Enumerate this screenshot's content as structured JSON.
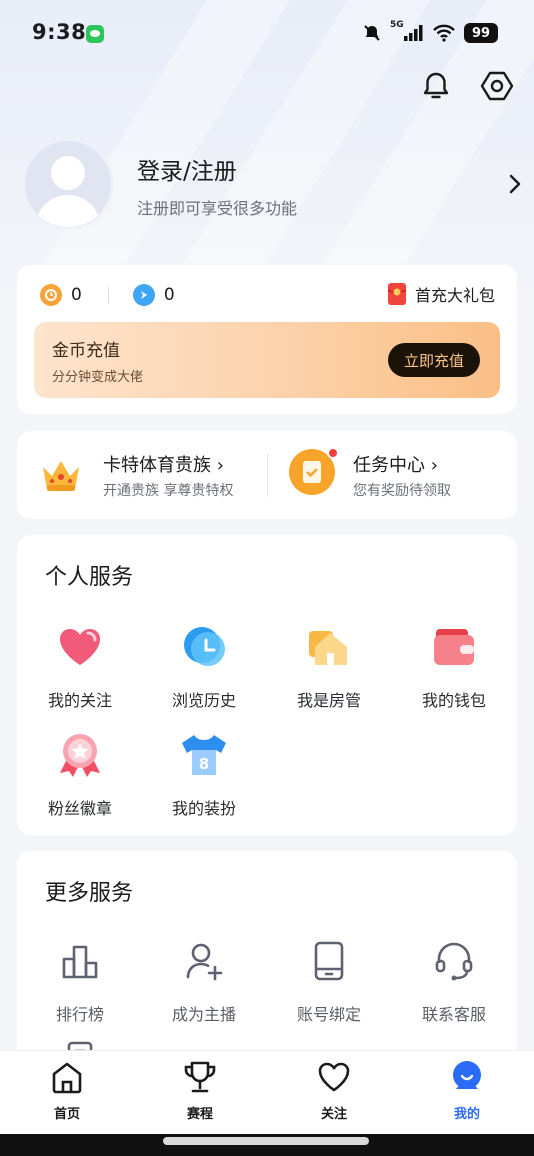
{
  "status_bar": {
    "time": "9:38",
    "network": "5G",
    "battery": "99"
  },
  "profile": {
    "title": "登录/注册",
    "subtitle": "注册即可享受很多功能"
  },
  "wallet": {
    "coin_count": "0",
    "diamond_count": "0",
    "gift_label": "首充大礼包",
    "recharge_title": "金币充值",
    "recharge_subtitle": "分分钟变成大佬",
    "recharge_button": "立即充值"
  },
  "promo": {
    "vip_title": "卡特体育贵族 ›",
    "vip_subtitle": "开通贵族 享尊贵特权",
    "task_title": "任务中心 ›",
    "task_subtitle": "您有奖励待领取"
  },
  "personal_services": {
    "title": "个人服务",
    "items": [
      {
        "label": "我的关注",
        "icon": "heart-icon"
      },
      {
        "label": "浏览历史",
        "icon": "clock-icon"
      },
      {
        "label": "我是房管",
        "icon": "house-icon"
      },
      {
        "label": "我的钱包",
        "icon": "wallet-icon"
      },
      {
        "label": "粉丝徽章",
        "icon": "badge-icon"
      },
      {
        "label": "我的装扮",
        "icon": "jersey-icon"
      }
    ]
  },
  "more_services": {
    "title": "更多服务",
    "items": [
      {
        "label": "排行榜",
        "icon": "ranking-icon"
      },
      {
        "label": "成为主播",
        "icon": "add-user-icon"
      },
      {
        "label": "账号绑定",
        "icon": "tablet-icon"
      },
      {
        "label": "联系客服",
        "icon": "headset-icon"
      }
    ]
  },
  "tabbar": {
    "items": [
      {
        "label": "首页",
        "icon": "home-icon"
      },
      {
        "label": "赛程",
        "icon": "trophy-icon"
      },
      {
        "label": "关注",
        "icon": "heart-outline-icon"
      },
      {
        "label": "我的",
        "icon": "profile-icon"
      }
    ],
    "active_color": "#2a6cf6"
  }
}
